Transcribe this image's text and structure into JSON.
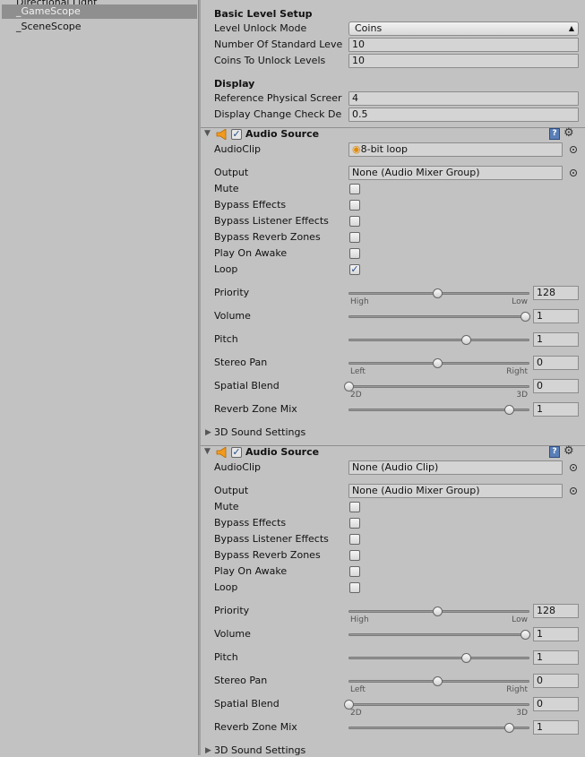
{
  "hierarchy": {
    "items": [
      {
        "label": "Directional Light"
      },
      {
        "label": "_GameScope",
        "selected": true
      },
      {
        "label": "_SceneScope"
      }
    ]
  },
  "inspector": {
    "basic": {
      "title": "Basic Level Setup",
      "level_unlock_mode": {
        "label": "Level Unlock Mode",
        "value": "Coins"
      },
      "num_standard_levels": {
        "label": "Number Of Standard Leve",
        "value": "10"
      },
      "coins_to_unlock": {
        "label": "Coins To Unlock Levels",
        "value": "10"
      }
    },
    "display": {
      "title": "Display",
      "ref_physical_screen": {
        "label": "Reference Physical Screer",
        "value": "4"
      },
      "display_change_check": {
        "label": "Display Change Check De",
        "value": "0.5"
      }
    },
    "audio_sources": [
      {
        "title": "Audio Source",
        "enabled": true,
        "icons": [
          "speaker-icon",
          "help-icon",
          "gear-icon"
        ],
        "audio_clip": {
          "label": "AudioClip",
          "value": "8-bit loop",
          "has_icon": true
        },
        "output": {
          "label": "Output",
          "value": "None (Audio Mixer Group)"
        },
        "toggles": [
          {
            "label": "Mute",
            "checked": false
          },
          {
            "label": "Bypass Effects",
            "checked": false
          },
          {
            "label": "Bypass Listener Effects",
            "checked": false
          },
          {
            "label": "Bypass Reverb Zones",
            "checked": false
          },
          {
            "label": "Play On Awake",
            "checked": false
          },
          {
            "label": "Loop",
            "checked": true
          }
        ],
        "sliders": [
          {
            "label": "Priority",
            "value": "128",
            "fraction": 0.5,
            "min_label": "High",
            "max_label": "Low"
          },
          {
            "label": "Volume",
            "value": "1",
            "fraction": 1.0
          },
          {
            "label": "Pitch",
            "value": "1",
            "fraction": 0.667
          },
          {
            "label": "Stereo Pan",
            "value": "0",
            "fraction": 0.5,
            "min_label": "Left",
            "max_label": "Right"
          },
          {
            "label": "Spatial Blend",
            "value": "0",
            "fraction": 0.0,
            "min_label": "2D",
            "max_label": "3D"
          },
          {
            "label": "Reverb Zone Mix",
            "value": "1",
            "fraction": 0.909
          }
        ],
        "sound_settings": "3D Sound Settings"
      },
      {
        "title": "Audio Source",
        "enabled": true,
        "icons": [
          "speaker-icon",
          "help-icon",
          "gear-icon"
        ],
        "audio_clip": {
          "label": "AudioClip",
          "value": "None (Audio Clip)",
          "has_icon": false
        },
        "output": {
          "label": "Output",
          "value": "None (Audio Mixer Group)"
        },
        "toggles": [
          {
            "label": "Mute",
            "checked": false
          },
          {
            "label": "Bypass Effects",
            "checked": false
          },
          {
            "label": "Bypass Listener Effects",
            "checked": false
          },
          {
            "label": "Bypass Reverb Zones",
            "checked": false
          },
          {
            "label": "Play On Awake",
            "checked": false
          },
          {
            "label": "Loop",
            "checked": false
          }
        ],
        "sliders": [
          {
            "label": "Priority",
            "value": "128",
            "fraction": 0.5,
            "min_label": "High",
            "max_label": "Low"
          },
          {
            "label": "Volume",
            "value": "1",
            "fraction": 1.0
          },
          {
            "label": "Pitch",
            "value": "1",
            "fraction": 0.667
          },
          {
            "label": "Stereo Pan",
            "value": "0",
            "fraction": 0.5,
            "min_label": "Left",
            "max_label": "Right"
          },
          {
            "label": "Spatial Blend",
            "value": "0",
            "fraction": 0.0,
            "min_label": "2D",
            "max_label": "3D"
          },
          {
            "label": "Reverb Zone Mix",
            "value": "1",
            "fraction": 0.909
          }
        ],
        "sound_settings": "3D Sound Settings"
      }
    ]
  }
}
